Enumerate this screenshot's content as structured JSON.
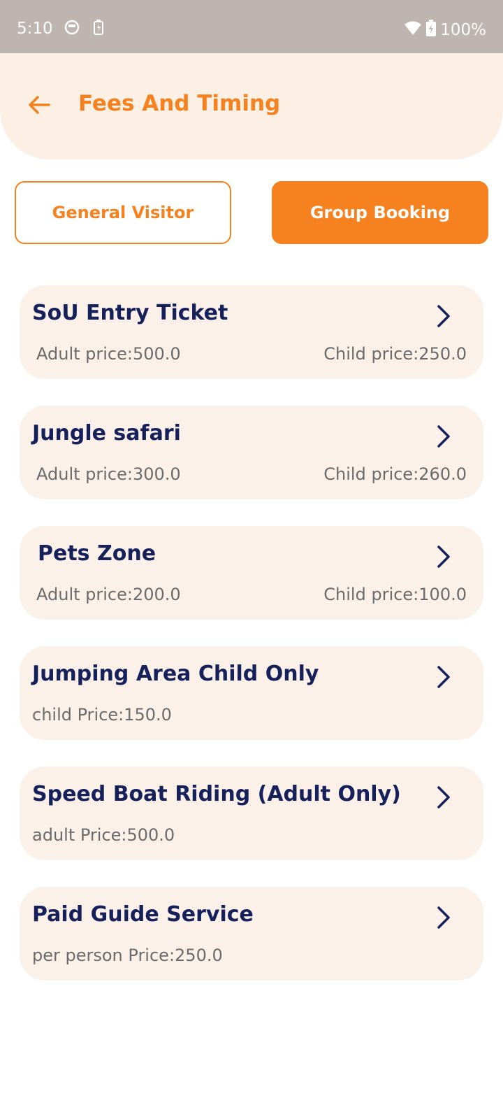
{
  "status_bar": {
    "time": "5:10",
    "battery_percent": "100%"
  },
  "header": {
    "title": "Fees And Timing"
  },
  "tabs": {
    "general": "General Visitor",
    "group": "Group Booking",
    "active": "group"
  },
  "items": [
    {
      "title": "SoU Entry Ticket",
      "left": "Adult price:500.0",
      "right": "Child price:250.0"
    },
    {
      "title": "Jungle safari",
      "left": "Adult price:300.0",
      "right": "Child price:260.0"
    },
    {
      "title": "Pets Zone",
      "left": "Adult price:200.0",
      "right": "Child price:100.0"
    },
    {
      "title": "Jumping Area Child Only",
      "left": "child Price:150.0",
      "right": ""
    },
    {
      "title": "Speed Boat Riding (Adult Only)",
      "left": "adult Price:500.0",
      "right": ""
    },
    {
      "title": "Paid Guide Service",
      "left": "per person Price:250.0",
      "right": ""
    }
  ],
  "colors": {
    "accent": "#f5821f",
    "title_text": "#16205a",
    "card_bg": "#fcf1e9",
    "header_bg": "#fcefe4"
  }
}
